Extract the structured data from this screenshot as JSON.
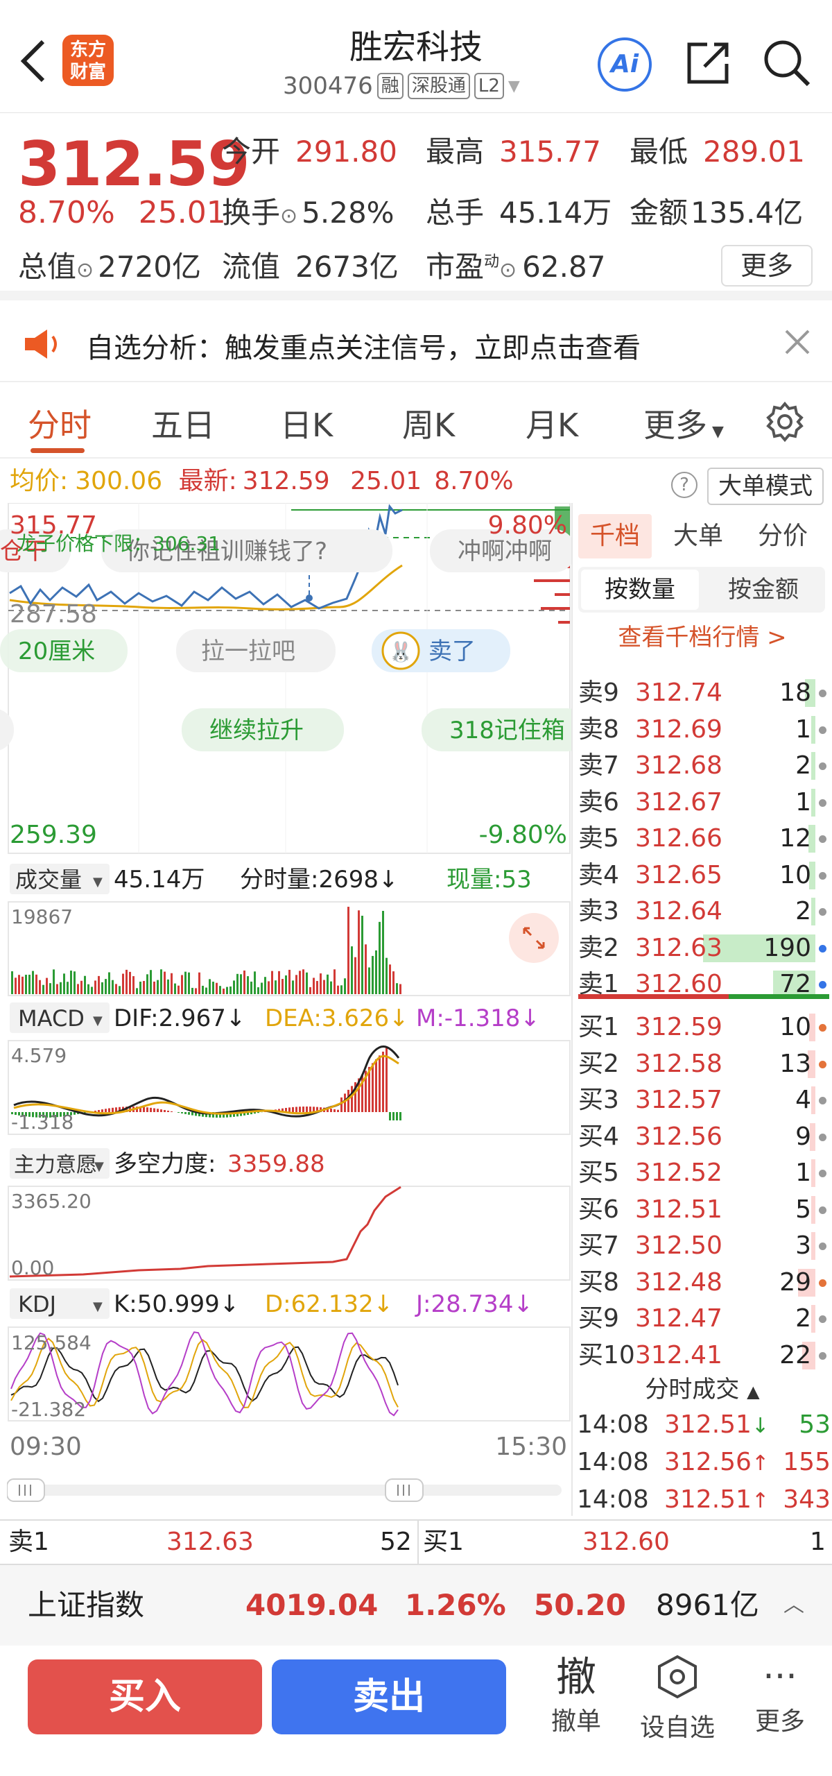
{
  "header": {
    "title": "胜宏科技",
    "code": "300476",
    "tags": [
      "融",
      "深股通",
      "L2"
    ],
    "logo_line1": "东方",
    "logo_line2": "财富",
    "ai_label": "Ai"
  },
  "quote": {
    "price": "312.59",
    "change_pct": "8.70%",
    "change": "25.01",
    "open_label": "今开",
    "open": "291.80",
    "high_label": "最高",
    "high": "315.77",
    "low_label": "最低",
    "low": "289.01",
    "turnover_label": "换手",
    "turnover": "5.28%",
    "volume_label": "总手",
    "volume": "45.14万",
    "amount_label": "金额",
    "amount": "135.4亿",
    "mktcap_label": "总值",
    "mktcap": "2720亿",
    "float_label": "流值",
    "float": "2673亿",
    "pe_label": "市盈",
    "pe_sup": "动",
    "pe": "62.87",
    "more": "更多"
  },
  "alert": {
    "text": "自选分析：触发重点关注信号，立即点击查看"
  },
  "tabs": [
    "分时",
    "五日",
    "日K",
    "周K",
    "月K",
    "更多"
  ],
  "avgline": {
    "avg_label": "均价:",
    "avg": "300.06",
    "last_label": "最新:",
    "last": "312.59",
    "chg": "25.01",
    "pct": "8.70%"
  },
  "bigorder_mode": "大单模式",
  "chart": {
    "price_top": "315.77",
    "price_mid": "287.58",
    "price_bottom": "259.39",
    "pct_top": "9.80%",
    "pct_bottom": "-9.80%",
    "limit_label": "龙子价格下限：306.31",
    "bubbles": [
      "仓干",
      "你记住祖训赚钱了?",
      "冲啊冲啊",
      "20厘米",
      "拉一拉吧",
      "卖了",
      "继续拉升",
      "318记住箱"
    ],
    "vol_sel": "成交量",
    "vol_total": "45.14万",
    "vol_fenshi": "分时量:2698↓",
    "vol_now": "现量:53",
    "vol_max": "19867",
    "macd_sel": "MACD",
    "macd_dif": "DIF:2.967↓",
    "macd_dea": "DEA:3.626↓",
    "macd_m": "M:-1.318↓",
    "macd_top": "4.579",
    "macd_bottom": "-1.318",
    "zl_sel": "主力意愿",
    "zl_label": "多空力度:",
    "zl_val": "3359.88",
    "zl_top": "3365.20",
    "zl_bottom": "0.00",
    "kdj_sel": "KDJ",
    "kdj_k": "K:50.999↓",
    "kdj_d": "D:62.132↓",
    "kdj_j": "J:28.734↓",
    "kdj_top": "125.584",
    "kdj_bottom": "-21.382",
    "time_start": "09:30",
    "time_end": "15:30"
  },
  "right_panel": {
    "tabs": [
      "千档",
      "大单",
      "分价"
    ],
    "subtabs": [
      "按数量",
      "按金额"
    ],
    "view_link": "查看千档行情 >",
    "asks": [
      {
        "label": "卖9",
        "price": "312.74",
        "vol": 18
      },
      {
        "label": "卖8",
        "price": "312.69",
        "vol": 1
      },
      {
        "label": "卖7",
        "price": "312.68",
        "vol": 2
      },
      {
        "label": "卖6",
        "price": "312.67",
        "vol": 1
      },
      {
        "label": "卖5",
        "price": "312.66",
        "vol": 12
      },
      {
        "label": "卖4",
        "price": "312.65",
        "vol": 10
      },
      {
        "label": "卖3",
        "price": "312.64",
        "vol": 2
      },
      {
        "label": "卖2",
        "price": "312.63",
        "vol": 190
      },
      {
        "label": "卖1",
        "price": "312.60",
        "vol": 72
      }
    ],
    "bids": [
      {
        "label": "买1",
        "price": "312.59",
        "vol": 10
      },
      {
        "label": "买2",
        "price": "312.58",
        "vol": 13
      },
      {
        "label": "买3",
        "price": "312.57",
        "vol": 4
      },
      {
        "label": "买4",
        "price": "312.56",
        "vol": 9
      },
      {
        "label": "买5",
        "price": "312.52",
        "vol": 1
      },
      {
        "label": "买6",
        "price": "312.51",
        "vol": 5
      },
      {
        "label": "买7",
        "price": "312.50",
        "vol": 3
      },
      {
        "label": "买8",
        "price": "312.48",
        "vol": 29
      },
      {
        "label": "买9",
        "price": "312.47",
        "vol": 2
      },
      {
        "label": "买10",
        "price": "312.41",
        "vol": 22
      }
    ],
    "ticks_title": "分时成交",
    "ticks": [
      {
        "time": "14:08",
        "price": "312.51",
        "dir": "↓",
        "vol": "53"
      },
      {
        "time": "14:08",
        "price": "312.56",
        "dir": "↑",
        "vol": "155"
      },
      {
        "time": "14:08",
        "price": "312.51",
        "dir": "↑",
        "vol": "343"
      }
    ]
  },
  "bidask": {
    "sell_label": "卖1",
    "sell_price": "312.63",
    "sell_vol": "52",
    "buy_label": "买1",
    "buy_price": "312.60",
    "buy_vol": "1"
  },
  "index_bar": {
    "name": "上证指数",
    "value": "4019.04",
    "pct": "1.26%",
    "chg": "50.20",
    "amount": "8961亿"
  },
  "actions": {
    "buy": "买入",
    "sell": "卖出",
    "cancel_big": "撤",
    "cancel": "撤单",
    "watch": "设自选",
    "more": "更多"
  }
}
